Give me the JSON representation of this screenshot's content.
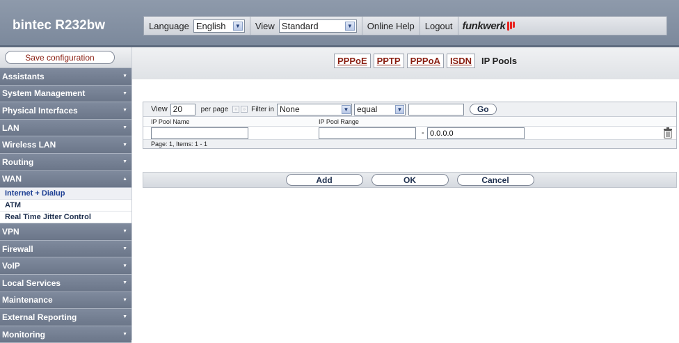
{
  "header": {
    "title": "bintec R232bw",
    "language_label": "Language",
    "language_value": "English",
    "view_label": "View",
    "view_value": "Standard",
    "online_help": "Online Help",
    "logout": "Logout",
    "logo_text": "funkwerk"
  },
  "sidebar": {
    "save_label": "Save configuration",
    "items": [
      {
        "label": "Assistants"
      },
      {
        "label": "System Management"
      },
      {
        "label": "Physical Interfaces"
      },
      {
        "label": "LAN"
      },
      {
        "label": "Wireless LAN"
      },
      {
        "label": "Routing"
      },
      {
        "label": "WAN"
      },
      {
        "label": "VPN"
      },
      {
        "label": "Firewall"
      },
      {
        "label": "VoIP"
      },
      {
        "label": "Local Services"
      },
      {
        "label": "Maintenance"
      },
      {
        "label": "External Reporting"
      },
      {
        "label": "Monitoring"
      }
    ],
    "wan_sub_items": [
      {
        "label": "Internet + Dialup"
      },
      {
        "label": "ATM"
      },
      {
        "label": "Real Time Jitter Control"
      }
    ]
  },
  "tabs": [
    {
      "label": "PPPoE"
    },
    {
      "label": "PPTP"
    },
    {
      "label": "PPPoA"
    },
    {
      "label": "ISDN"
    },
    {
      "label": "IP Pools"
    }
  ],
  "list": {
    "view_label": "View",
    "per_page_value": "20",
    "per_page_label": "per page",
    "filter_label": "Filter in",
    "filter_field": "None",
    "filter_op": "equal",
    "filter_value": "",
    "go_label": "Go",
    "col_name": "IP Pool Name",
    "col_range": "IP Pool Range",
    "row": {
      "name": "",
      "range_start": "",
      "range_sep": "-",
      "range_end": "0.0.0.0"
    },
    "footer": "Page: 1, Items: 1 - 1"
  },
  "actions": {
    "add": "Add",
    "ok": "OK",
    "cancel": "Cancel"
  }
}
